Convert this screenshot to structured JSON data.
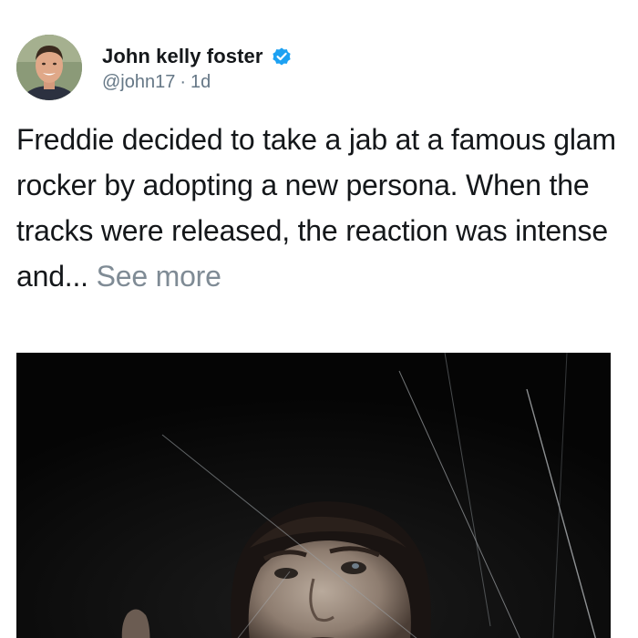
{
  "author": {
    "display_name": "John kelly foster",
    "handle": "@john17",
    "separator": "·",
    "time_ago": "1d",
    "verified": true,
    "verified_color": "#1da1f2"
  },
  "tweet": {
    "text": "Freddie decided to take a jab at a famous glam rocker by adopting a new persona. When the tracks were released, the reaction was intense and...",
    "see_more_label": "See more"
  },
  "icons": {
    "verified": "verified-check-icon"
  },
  "colors": {
    "text": "#14171a",
    "secondary": "#657786",
    "see_more": "#7f8b95",
    "photo_bg": "#0a0a0a"
  }
}
